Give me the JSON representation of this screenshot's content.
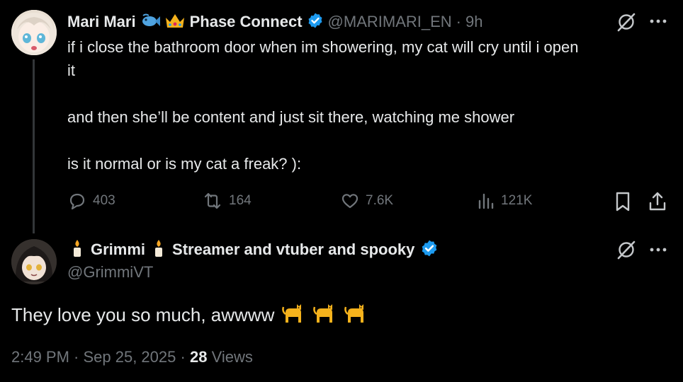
{
  "parent_tweet": {
    "display_name": "Mari Mari",
    "affiliation": "Phase Connect",
    "handle": "@MARIMARI_EN",
    "separator": "·",
    "time": "9h",
    "text_line1": "if i close the bathroom door when im showering, my cat will cry until i open",
    "text_line2": "it",
    "text_line3": "and then she’ll be content and just sit there, watching me shower",
    "text_line4": "is it normal or is my cat a freak? ):",
    "replies": "403",
    "reposts": "164",
    "likes": "7.6K",
    "views": "121K"
  },
  "reply_tweet": {
    "display_name_1": "Grimmi",
    "display_name_2": "Streamer and vtuber and spooky",
    "handle": "@GrimmiVT",
    "text": "They love you so much, awwww",
    "timestamp": "2:49 PM · Sep 25, 2025 ·",
    "view_count": "28",
    "views_label": "Views"
  },
  "colors": {
    "background": "#000000",
    "text": "#e7e9ea",
    "muted": "#71767b",
    "verified": "#1d9bf0",
    "thread_line": "#333639"
  }
}
